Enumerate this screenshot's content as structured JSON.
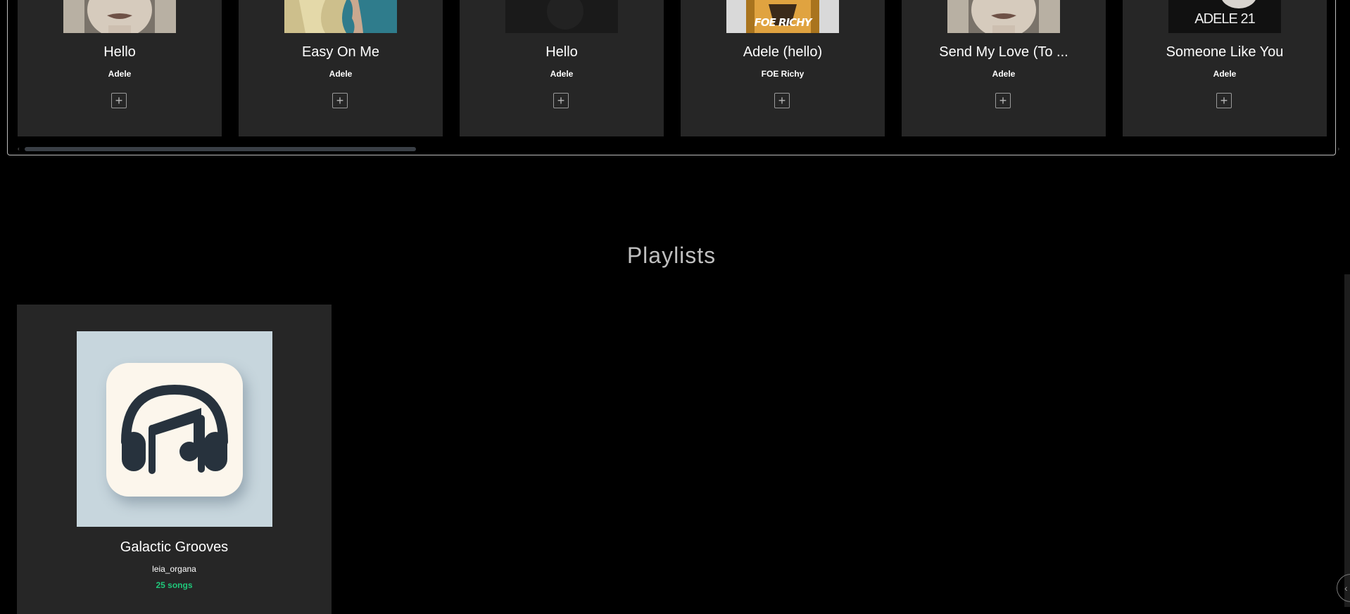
{
  "songs": [
    {
      "title": "Hello",
      "artist": "Adele",
      "art": "adele-portrait"
    },
    {
      "title": "Easy On Me",
      "artist": "Adele",
      "art": "adele-profile"
    },
    {
      "title": "Hello",
      "artist": "Adele",
      "art": "dark-cover"
    },
    {
      "title": "Adele (hello)",
      "artist": "FOE Richy",
      "art": "foe-richy-cover",
      "art_text": "FOE RICHY"
    },
    {
      "title": "Send My Love (To ...",
      "artist": "Adele",
      "art": "adele-portrait"
    },
    {
      "title": "Someone Like You",
      "artist": "Adele",
      "art": "adele-21-cover",
      "art_text": "ADELE 21"
    }
  ],
  "add_icon": "plus-square-icon",
  "playlists_section": {
    "title": "Playlists"
  },
  "playlists": [
    {
      "name": "Galactic Grooves",
      "owner": "leia_organa",
      "count": "25 songs",
      "cover_icon": "headphones-music-icon"
    }
  ],
  "colors": {
    "card_bg": "#262626",
    "accent_green": "#1fc77a",
    "page_bg": "#000000"
  }
}
